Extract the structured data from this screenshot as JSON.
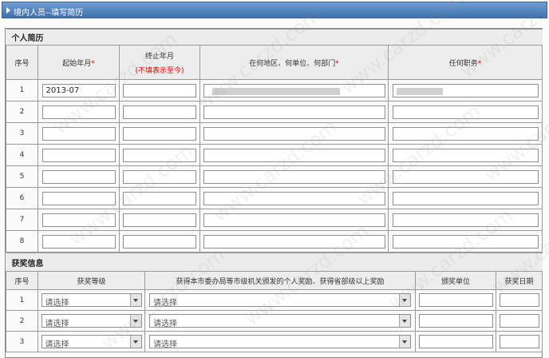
{
  "title": "境内人员--填写简历",
  "watermark": "www.carzd.com",
  "resume": {
    "section_title": "个人简历",
    "headers": {
      "num": "序号",
      "start": "起始年月",
      "end": "终止年月",
      "end_note": "(不填表示至今)",
      "unit": "在何地区、何单位、何部门",
      "position": "任何职务",
      "required_mark": "*"
    },
    "rows": [
      {
        "num": "1",
        "start": "2013-07",
        "end": "",
        "unit": "",
        "position": ""
      },
      {
        "num": "2",
        "start": "",
        "end": "",
        "unit": "",
        "position": ""
      },
      {
        "num": "3",
        "start": "",
        "end": "",
        "unit": "",
        "position": ""
      },
      {
        "num": "4",
        "start": "",
        "end": "",
        "unit": "",
        "position": ""
      },
      {
        "num": "5",
        "start": "",
        "end": "",
        "unit": "",
        "position": ""
      },
      {
        "num": "6",
        "start": "",
        "end": "",
        "unit": "",
        "position": ""
      },
      {
        "num": "7",
        "start": "",
        "end": "",
        "unit": "",
        "position": ""
      },
      {
        "num": "8",
        "start": "",
        "end": "",
        "unit": "",
        "position": ""
      }
    ]
  },
  "awards": {
    "section_title": "获奖信息",
    "headers": {
      "num": "序号",
      "level": "获奖等级",
      "desc": "获得本市委办局等市级机关颁发的个人奖励、获得省部级以上奖励",
      "unit": "颁奖单位",
      "date": "获奖日期"
    },
    "select_placeholder": "请选择",
    "rows": [
      {
        "num": "1"
      },
      {
        "num": "2"
      },
      {
        "num": "3"
      }
    ]
  }
}
